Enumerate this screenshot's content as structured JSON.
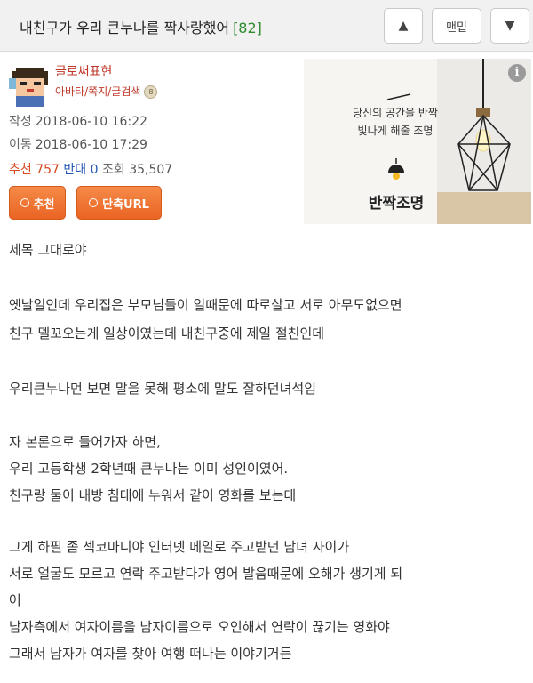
{
  "header": {
    "title": "내친구가 우리 큰누나를 짝사랑했어",
    "comment_count": "[82]",
    "up_symbol": "▲",
    "bottom_label": "맨밑",
    "down_symbol": "▼"
  },
  "author": {
    "name": "글로써표현",
    "links": "아바타/쪽지/글검색"
  },
  "meta": {
    "written_label": "작성",
    "written_value": "2018-06-10 16:22",
    "moved_label": "이동",
    "moved_value": "2018-06-10 17:29",
    "recommend_label": "추천",
    "recommend_value": "757",
    "oppose_label": "반대",
    "oppose_value": "0",
    "views_label": "조회",
    "views_value": "35,507"
  },
  "actions": {
    "recommend_label": "추천",
    "short_url_label": "단축URL"
  },
  "ad": {
    "info_symbol": "i",
    "line1": "당신의 공간을 반짝",
    "line2": "빛나게 해줄 조명",
    "title": "반짝조명"
  },
  "body": {
    "lines": [
      "제목 그대로야",
      "옛날일인데 우리집은 부모님들이 일때문에 따로살고 서로 아무도없으면",
      "친구 델꼬오는게 일상이였는데 내친구중에 제일 절친인데",
      "우리큰누나먼 보면 말을 못해 평소에 말도 잘하던녀석임",
      "자 본론으로 들어가자 하면,",
      "우리 고등학생 2학년때 큰누나는 이미 성인이였어.",
      "친구랑 둘이 내방 침대에 누워서 같이 영화를 보는데",
      "그게 하필 좀 섹코마디야 인터넷 메일로 주고받던 남녀 사이가",
      "서로 얼굴도 모르고 연락 주고받다가 영어 발음때문에 오해가 생기게 되",
      "어",
      "남자측에서 여자이름을 남자이름으로 오인해서 연락이 끊기는 영화야",
      "그래서 남자가 여자를 찾아 여행 떠나는 이야기거든"
    ]
  }
}
